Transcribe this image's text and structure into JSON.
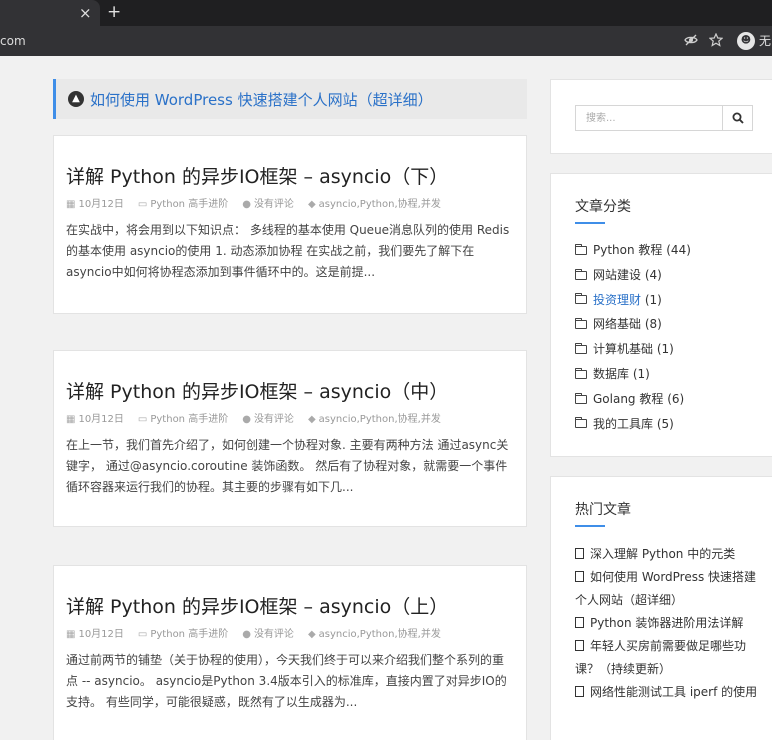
{
  "browser": {
    "tab_close": "×",
    "tab_new": "+",
    "url_tail": "com",
    "avatar_text": "☻",
    "profile_text": "无"
  },
  "sticky": {
    "text": "如何使用 WordPress 快速搭建个人网站（超详细）"
  },
  "posts": [
    {
      "title": "详解 Python 的异步IO框架 – asyncio（下）",
      "date": "10月12日",
      "category": "Python 高手进阶",
      "comments": "没有评论",
      "tags": "asyncio,Python,协程,并发",
      "excerpt": "在实战中，将会用到以下知识点： 多线程的基本使用 Queue消息队列的使用 Redis的基本使用 asyncio的使用 1. 动态添加协程 在实战之前，我们要先了解下在asyncio中如何将协程态添加到事件循环中的。这是前提..."
    },
    {
      "title": "详解 Python 的异步IO框架 – asyncio（中）",
      "date": "10月12日",
      "category": "Python 高手进阶",
      "comments": "没有评论",
      "tags": "asyncio,Python,协程,并发",
      "excerpt": "在上一节，我们首先介绍了，如何创建一个协程对象. 主要有两种方法 通过async关键字， 通过@asyncio.coroutine 装饰函数。 然后有了协程对象，就需要一个事件循环容器来运行我们的协程。其主要的步骤有如下几..."
    },
    {
      "title": "详解 Python 的异步IO框架 – asyncio（上）",
      "date": "10月12日",
      "category": "Python 高手进阶",
      "comments": "没有评论",
      "tags": "asyncio,Python,协程,并发",
      "excerpt": "通过前两节的铺垫（关于协程的使用），今天我们终于可以来介绍我们整个系列的重点 -- asyncio。 asyncio是Python 3.4版本引入的标准库，直接内置了对异步IO的支持。 有些同学，可能很疑惑，既然有了以生成器为..."
    }
  ],
  "search": {
    "placeholder": "搜索..."
  },
  "categories": {
    "title": "文章分类",
    "items": [
      {
        "name": "Python 教程",
        "count": "(44)"
      },
      {
        "name": "网站建设",
        "count": "(4)"
      },
      {
        "name": "投资理财",
        "count": "(1)"
      },
      {
        "name": "网络基础",
        "count": "(8)"
      },
      {
        "name": "计算机基础",
        "count": "(1)"
      },
      {
        "name": "数据库",
        "count": "(1)"
      },
      {
        "name": "Golang 教程",
        "count": "(6)"
      },
      {
        "name": "我的工具库",
        "count": "(5)"
      }
    ]
  },
  "hot": {
    "title": "热门文章",
    "items": [
      "深入理解 Python 中的元类",
      "如何使用 WordPress 快速搭建个人网站（超详细）",
      "Python 装饰器进阶用法详解",
      "年轻人买房前需要做足哪些功课？（持续更新）",
      "网络性能测试工具 iperf 的使用"
    ]
  },
  "colors": {
    "accent": "#3f8ee8",
    "link": "#2a71c8"
  }
}
